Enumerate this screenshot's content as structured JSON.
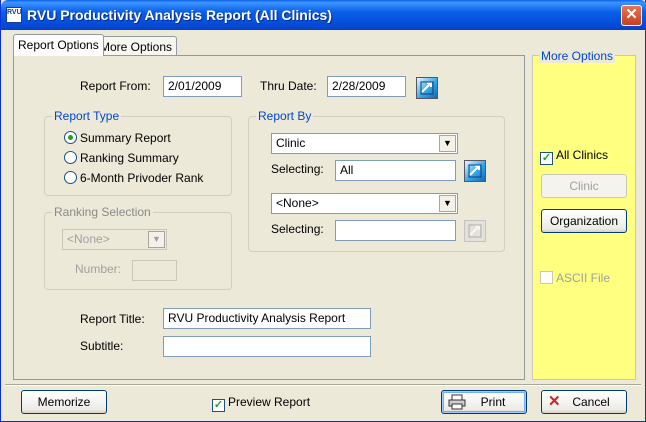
{
  "window": {
    "title": "RVU Productivity Analysis Report (All Clinics)",
    "app_icon_text": "RVU",
    "close_symbol": "✕"
  },
  "tabs": [
    {
      "label": "Report Options",
      "active": true
    },
    {
      "label": "More Options",
      "active": false
    }
  ],
  "dates": {
    "from_label": "Report From:",
    "from_value": "2/01/2009",
    "thru_label": "Thru Date:",
    "thru_value": "2/28/2009"
  },
  "report_type": {
    "title": "Report Type",
    "options": [
      {
        "label": "Summary Report",
        "checked": true
      },
      {
        "label": "Ranking Summary",
        "checked": false
      },
      {
        "label": "6-Month Privoder Rank",
        "checked": false
      }
    ]
  },
  "report_by": {
    "title": "Report By",
    "select1_value": "Clinic",
    "selecting1_label": "Selecting:",
    "selecting1_value": "All",
    "select2_value": "<None>",
    "selecting2_label": "Selecting:",
    "selecting2_value": ""
  },
  "ranking_selection": {
    "title": "Ranking Selection",
    "select_value": "<None>",
    "number_label": "Number:",
    "number_value": ""
  },
  "titles": {
    "report_title_label": "Report Title:",
    "report_title_value": "RVU Productivity Analysis Report",
    "subtitle_label": "Subtitle:",
    "subtitle_value": ""
  },
  "more_options": {
    "title": "More Options",
    "all_clinics_label": "All Clinics",
    "all_clinics_checked": true,
    "clinic_button": "Clinic",
    "organization_button": "Organization",
    "ascii_label": "ASCII File",
    "ascii_checked": false
  },
  "footer": {
    "memorize_button": "Memorize",
    "preview_label": "Preview Report",
    "preview_checked": true,
    "print_button": "Print",
    "cancel_button": "Cancel"
  },
  "icons": {
    "lookup": "lookup-icon",
    "printer": "printer-icon",
    "cancel": "cancel-x-icon",
    "dropdown": "chevron-down-icon"
  }
}
